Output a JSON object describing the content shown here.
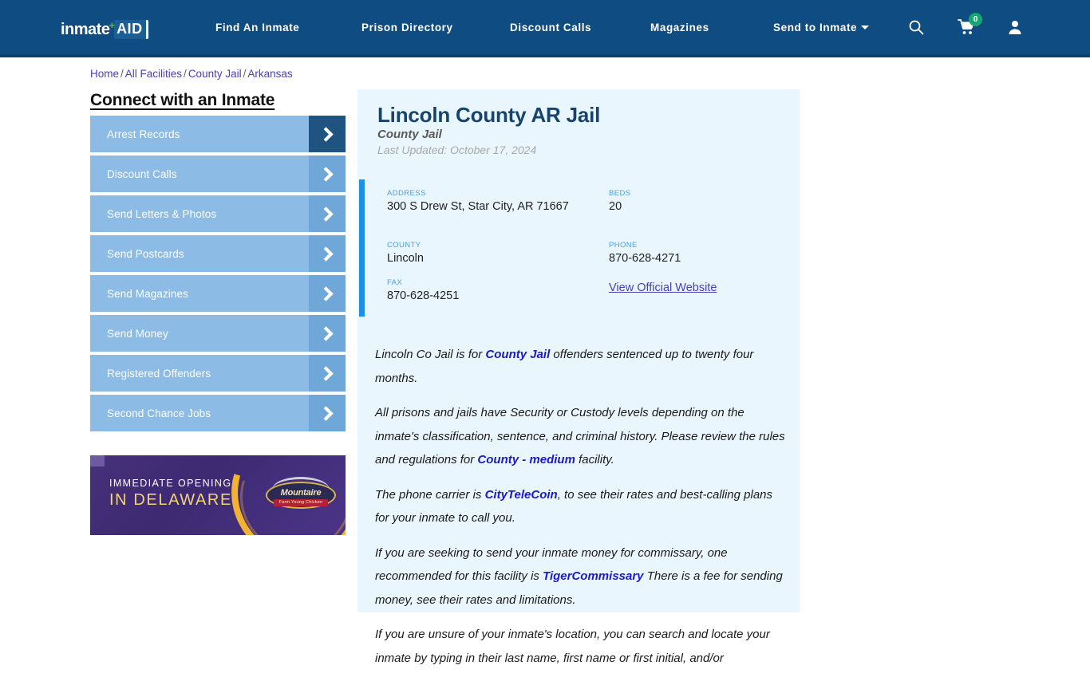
{
  "header": {
    "logo": {
      "word": "inmate",
      "plus": "+",
      "badge": "AID"
    },
    "nav": [
      {
        "label": "Find An Inmate"
      },
      {
        "label": "Prison Directory"
      },
      {
        "label": "Discount Calls"
      },
      {
        "label": "Magazines"
      },
      {
        "label": "Send to Inmate",
        "has_caret": true
      }
    ],
    "icons": {
      "search": "search-icon",
      "cart": "shopping-cart-icon",
      "cart_count": "0",
      "user": "user-account-icon"
    },
    "colors": {
      "background": "#0f4c81",
      "badge_green": "#17a673"
    }
  },
  "breadcrumb": {
    "items": [
      "Home",
      "All Facilities",
      "County Jail",
      "Arkansas"
    ],
    "separator": "/"
  },
  "sidebar": {
    "title": "Connect with an Inmate",
    "buttons": [
      {
        "label": "Arrest Records",
        "active": true
      },
      {
        "label": "Discount Calls",
        "active": false
      },
      {
        "label": "Send Letters & Photos",
        "active": false
      },
      {
        "label": "Send Postcards",
        "active": false
      },
      {
        "label": "Send Magazines",
        "active": false
      },
      {
        "label": "Send Money",
        "active": false
      },
      {
        "label": "Registered Offenders",
        "active": false
      },
      {
        "label": "Second Chance Jobs",
        "active": false
      }
    ],
    "ad": {
      "line1": "IMMEDIATE OPENING",
      "line2": "IN DELAWARE",
      "logo_name": "Mountaire",
      "logo_sub": "Farm Young Chicken"
    }
  },
  "facility": {
    "title": "Lincoln County AR Jail",
    "subtitle": "County Jail",
    "last_updated": "Last Updated: October 17, 2024",
    "info": {
      "address_label": "ADDRESS",
      "address_value": "300 S Drew St, Star City, AR 71667",
      "beds_label": "BEDS",
      "beds_value": "20",
      "county_label": "COUNTY",
      "county_value": "Lincoln",
      "phone_label": "PHONE",
      "phone_value": "870-628-4271",
      "fax_label": "FAX",
      "fax_value": "870-628-4251",
      "website_link": "View Official Website"
    },
    "paragraphs": {
      "p1_a": "Lincoln Co Jail is for ",
      "p1_b": "County Jail",
      "p1_c": " offenders sentenced up to twenty four months.",
      "p2_a": "All prisons and jails have Security or Custody levels depending on the inmate's classification, sentence, and criminal history. Please review the rules and regulations for ",
      "p2_b": "County - medium",
      "p2_c": " facility.",
      "p3_a": "The phone carrier is ",
      "p3_b": "CityTeleCoin",
      "p3_c": ", to see their rates and best-calling plans for your inmate to call you.",
      "p4_a": "If you are seeking to send your inmate money for commissary, one recommended for this facility is ",
      "p4_b": "TigerCommissary",
      "p4_c": " There is a fee for sending money, see their rates and limitations.",
      "p5_a": "If you are unsure of your inmate's location, you can search and locate your inmate by typing in their last name, first name or first initial, and/or"
    }
  }
}
